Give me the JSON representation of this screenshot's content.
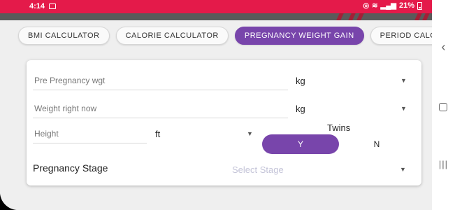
{
  "status_bar": {
    "time": "4:14",
    "battery": "21%",
    "accent_color": "#e41a4a"
  },
  "tabs": [
    {
      "label": "BMI CALCULATOR",
      "active": false
    },
    {
      "label": "CALORIE CALCULATOR",
      "active": false
    },
    {
      "label": "PREGNANCY WEIGHT GAIN",
      "active": true
    },
    {
      "label": "PERIOD CALCULATOR",
      "active": false
    }
  ],
  "form": {
    "pre_pregnancy_placeholder": "Pre Pregnancy wgt",
    "pre_pregnancy_unit": "kg",
    "current_weight_placeholder": "Weight right now",
    "current_weight_unit": "kg",
    "height_placeholder": "Height",
    "height_unit": "ft",
    "twins_label": "Twins",
    "twins_yes": "Y",
    "twins_no": "N",
    "stage_label": "Pregnancy Stage",
    "stage_placeholder": "Select Stage"
  },
  "theme": {
    "primary": "#7845ab",
    "background": "#efefef"
  }
}
